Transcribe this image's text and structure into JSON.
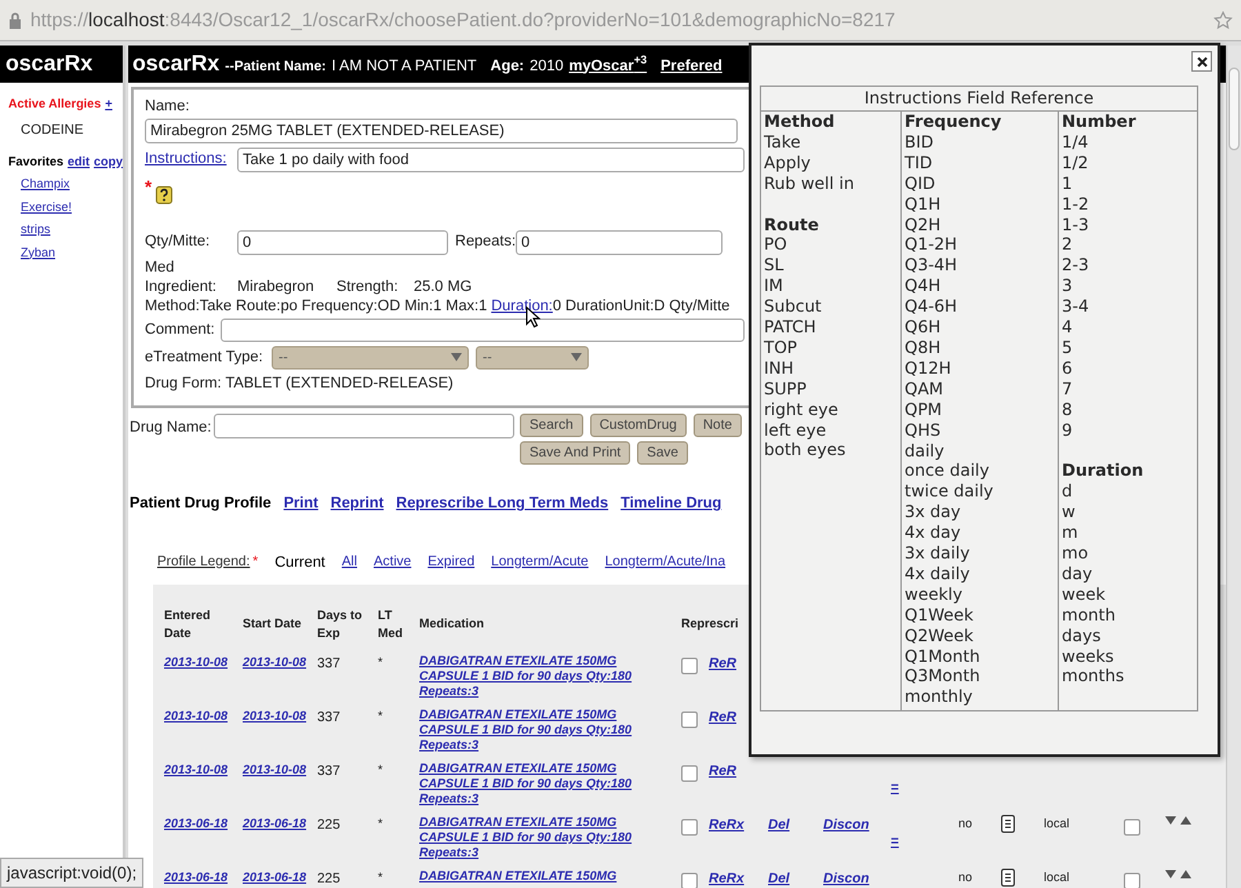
{
  "browser": {
    "scheme": "https://",
    "host": "localhost",
    "rest": ":8443/Oscar12_1/oscarRx/choosePatient.do?providerNo=101&demographicNo=8217"
  },
  "sidebar": {
    "logo": "oscarRx",
    "allergies_label": "Active Allergies",
    "allergies_add": "+",
    "allergies": [
      "CODEINE"
    ],
    "favorites_label": "Favorites",
    "favorites_actions": [
      "edit",
      "copy"
    ],
    "favorites": [
      "Champix",
      "Exercise!",
      "strips",
      "Zyban"
    ]
  },
  "header": {
    "logo": "oscarRx",
    "patient_label": "--Patient Name:",
    "patient_name": "I AM NOT A PATIENT",
    "age_label": "Age:",
    "age": "2010",
    "myoscar": "myOscar",
    "myoscar_badge": "+3",
    "preferred": "Prefered"
  },
  "form": {
    "name_label": "Name:",
    "name_value": "Mirabegron 25MG TABLET (EXTENDED-RELEASE)",
    "instructions_label": "Instructions:",
    "instructions_value": "Take 1 po daily with food",
    "required_mark": "*",
    "qty_label": "Qty/Mitte:",
    "qty_value": "0",
    "repeats_label": "Repeats:",
    "repeats_value": "0",
    "med": "Med",
    "ingredient_label": "Ingredient:",
    "ingredient": "Mirabegron",
    "strength_label": "Strength:",
    "strength": "25.0 MG",
    "parse_before": "Method:Take Route:po Frequency:OD Min:1 Max:1",
    "duration_link": "Duration:",
    "parse_after": "0 DurationUnit:D Qty/Mitte",
    "comment_label": "Comment:",
    "etreatment_label": "eTreatment Type:",
    "selects": [
      "--",
      "--"
    ],
    "drug_form": "Drug Form: TABLET (EXTENDED-RELEASE)"
  },
  "search": {
    "label": "Drug Name:",
    "buttons_top": [
      "Search",
      "CustomDrug",
      "Note"
    ],
    "buttons_bottom": [
      "Save And Print",
      "Save"
    ]
  },
  "profile": {
    "title": "Patient Drug Profile",
    "links": [
      "Print",
      "Reprint",
      "Represcribe Long Term Meds",
      "Timeline Drug"
    ],
    "legend_label": "Profile Legend:",
    "legend_mark": "*",
    "legend_items": [
      {
        "label": "Current",
        "selected": true
      },
      {
        "label": "All",
        "selected": false
      },
      {
        "label": "Active",
        "selected": false
      },
      {
        "label": "Expired",
        "selected": false
      },
      {
        "label": "Longterm/Acute",
        "selected": false
      },
      {
        "label": "Longterm/Acute/Ina",
        "selected": false
      }
    ]
  },
  "table": {
    "columns": [
      "Entered Date",
      "Start Date",
      "Days to Exp",
      "LT Med",
      "Medication",
      "Represcri"
    ],
    "rows": [
      {
        "kind": "partial",
        "entered": "2013-10-08",
        "start": "2013-10-08",
        "days": "337",
        "lt": "*",
        "medication": "DABIGATRAN ETEXILATE 150MG\nCAPSULE 1 BID for 90 days Qty:180\nRepeats:3",
        "checked": false,
        "rerx": "ReR"
      },
      {
        "kind": "partial",
        "entered": "2013-10-08",
        "start": "2013-10-08",
        "days": "337",
        "lt": "*",
        "medication": "DABIGATRAN ETEXILATE 150MG\nCAPSULE 1 BID for 90 days Qty:180\nRepeats:3",
        "checked": false,
        "rerx": "ReR"
      },
      {
        "kind": "partial",
        "entered": "2013-10-08",
        "start": "2013-10-08",
        "days": "337",
        "lt": "*",
        "medication": "DABIGATRAN ETEXILATE 150MG\nCAPSULE 1 BID for 90 days Qty:180\nRepeats:3",
        "checked": false,
        "rerx": "ReR",
        "link": "="
      },
      {
        "kind": "full",
        "entered": "2013-06-18",
        "start": "2013-06-18",
        "days": "225",
        "lt": "*",
        "medication": "DABIGATRAN ETEXILATE 150MG\nCAPSULE 1 BID for 90 days Qty:180\nRepeats:3",
        "checked": false,
        "rerx": "ReRx",
        "del": "Del",
        "discon": "Discon",
        "link": "=",
        "archived": "no",
        "source": "local",
        "long_term_checked": false
      },
      {
        "kind": "full",
        "entered": "2013-06-18",
        "start": "2013-06-18",
        "days": "225",
        "lt": "*",
        "medication": "DABIGATRAN ETEXILATE 150MG",
        "checked": false,
        "rerx": "ReRx",
        "del": "Del",
        "discon": "Discon",
        "archived": "no",
        "source": "local",
        "long_term_checked": false
      }
    ]
  },
  "popup": {
    "title": "Instructions Field Reference",
    "columns": [
      [
        {
          "heading": "Method",
          "items": [
            "Take",
            "Apply",
            "Rub well in"
          ]
        },
        {
          "heading": "Route",
          "items": [
            "PO",
            "SL",
            "IM",
            "Subcut",
            "PATCH",
            "TOP",
            "INH",
            "SUPP",
            "right eye",
            "left eye",
            "both eyes"
          ]
        }
      ],
      [
        {
          "heading": "Frequency",
          "items": [
            "BID",
            "TID",
            "QID",
            "Q1H",
            "Q2H",
            "Q1-2H",
            "Q3-4H",
            "Q4H",
            "Q4-6H",
            "Q6H",
            "Q8H",
            "Q12H",
            "QAM",
            "QPM",
            "QHS",
            "daily",
            "once daily",
            "twice daily",
            "3x day",
            "4x day",
            "3x daily",
            "4x daily",
            "weekly",
            "Q1Week",
            "Q2Week",
            "Q1Month",
            "Q3Month",
            "monthly"
          ]
        }
      ],
      [
        {
          "heading": "Number",
          "items": [
            "1/4",
            "1/2",
            "1",
            "1-2",
            "1-3",
            "2",
            "2-3",
            "3",
            "3-4",
            "4",
            "5",
            "6",
            "7",
            "8",
            "9"
          ]
        },
        {
          "heading": "Duration",
          "items": [
            "d",
            "w",
            "m",
            "mo",
            "day",
            "week",
            "month",
            "days",
            "weeks",
            "months"
          ]
        }
      ]
    ]
  },
  "status_bar": "javascript:void(0);"
}
